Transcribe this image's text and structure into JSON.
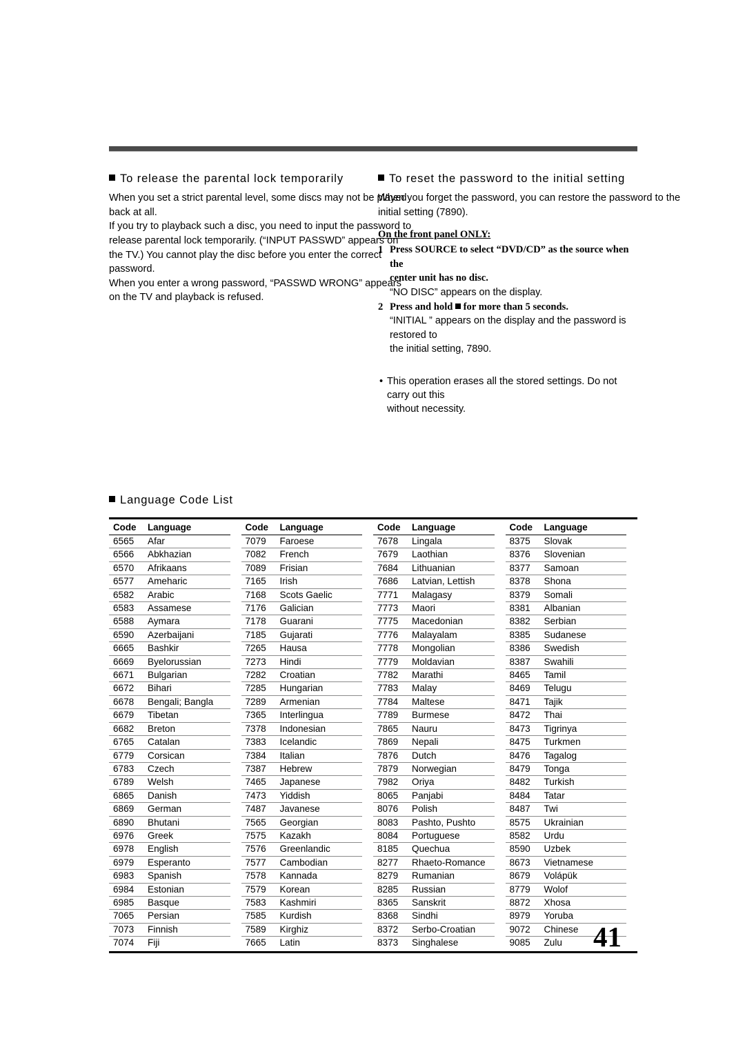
{
  "page": {
    "number": "41"
  },
  "sections": {
    "release_lock": {
      "heading": "To release the parental lock temporarily",
      "p1_line1": "When you set a strict parental level, some discs may not be played",
      "p1_line2": "back at all.",
      "p2_line1": "If you try to playback such a disc, you need to input the password to",
      "p2_line2a": "release parental lock temporarily. (",
      "p2_line2b": "“INPUT PASSWD”",
      "p2_line2c": " appears on",
      "p2_line3": "the TV.)  You cannot play the disc before you enter the correct",
      "p2_line4": "password.",
      "p3_line1a": "When you enter a wrong password, ",
      "p3_line1b": "“PASSWD WRONG”",
      "p3_line1c": " appears",
      "p3_line2": "on the TV and playback is refused."
    },
    "reset_password": {
      "heading": "To reset the password to the initial setting",
      "p1_line1": "When you forget the password, you can restore the password to the",
      "p1_line2": "initial setting (7890).",
      "front_panel_label": "On the front panel ONLY:",
      "steps": [
        {
          "num": "1",
          "bold_line1": "Press SOURCE to select “DVD/CD” as the source when the",
          "bold_line2": "center unit has no disc.",
          "plain_line": "“NO DISC” appears on the display."
        },
        {
          "num": "2",
          "bold_prefix": "Press and hold ",
          "bold_suffix": " for more than 5 seconds.",
          "plain_line1": "“INITIAL ” appears on the display and the password is restored to",
          "plain_line2": "the initial setting, 7890."
        }
      ],
      "note_line1": "This operation erases all the stored settings. Do not carry out this",
      "note_line2": "without necessity."
    }
  },
  "language_code_list": {
    "heading": "Language Code List",
    "headers": {
      "code": "Code",
      "language": "Language"
    },
    "columns": [
      [
        [
          "6565",
          "Afar"
        ],
        [
          "6566",
          "Abkhazian"
        ],
        [
          "6570",
          "Afrikaans"
        ],
        [
          "6577",
          "Ameharic"
        ],
        [
          "6582",
          "Arabic"
        ],
        [
          "6583",
          "Assamese"
        ],
        [
          "6588",
          "Aymara"
        ],
        [
          "6590",
          "Azerbaijani"
        ],
        [
          "6665",
          "Bashkir"
        ],
        [
          "6669",
          "Byelorussian"
        ],
        [
          "6671",
          "Bulgarian"
        ],
        [
          "6672",
          "Bihari"
        ],
        [
          "6678",
          "Bengali; Bangla"
        ],
        [
          "6679",
          "Tibetan"
        ],
        [
          "6682",
          "Breton"
        ],
        [
          "6765",
          "Catalan"
        ],
        [
          "6779",
          "Corsican"
        ],
        [
          "6783",
          "Czech"
        ],
        [
          "6789",
          "Welsh"
        ],
        [
          "6865",
          "Danish"
        ],
        [
          "6869",
          "German"
        ],
        [
          "6890",
          "Bhutani"
        ],
        [
          "6976",
          "Greek"
        ],
        [
          "6978",
          "English"
        ],
        [
          "6979",
          "Esperanto"
        ],
        [
          "6983",
          "Spanish"
        ],
        [
          "6984",
          "Estonian"
        ],
        [
          "6985",
          "Basque"
        ],
        [
          "7065",
          "Persian"
        ],
        [
          "7073",
          "Finnish"
        ],
        [
          "7074",
          "Fiji"
        ]
      ],
      [
        [
          "7079",
          "Faroese"
        ],
        [
          "7082",
          "French"
        ],
        [
          "7089",
          "Frisian"
        ],
        [
          "7165",
          "Irish"
        ],
        [
          "7168",
          "Scots Gaelic"
        ],
        [
          "7176",
          "Galician"
        ],
        [
          "7178",
          "Guarani"
        ],
        [
          "7185",
          "Gujarati"
        ],
        [
          "7265",
          "Hausa"
        ],
        [
          "7273",
          "Hindi"
        ],
        [
          "7282",
          "Croatian"
        ],
        [
          "7285",
          "Hungarian"
        ],
        [
          "7289",
          "Armenian"
        ],
        [
          "7365",
          "Interlingua"
        ],
        [
          "7378",
          "Indonesian"
        ],
        [
          "7383",
          "Icelandic"
        ],
        [
          "7384",
          "Italian"
        ],
        [
          "7387",
          "Hebrew"
        ],
        [
          "7465",
          "Japanese"
        ],
        [
          "7473",
          "Yiddish"
        ],
        [
          "7487",
          "Javanese"
        ],
        [
          "7565",
          "Georgian"
        ],
        [
          "7575",
          "Kazakh"
        ],
        [
          "7576",
          "Greenlandic"
        ],
        [
          "7577",
          "Cambodian"
        ],
        [
          "7578",
          "Kannada"
        ],
        [
          "7579",
          "Korean"
        ],
        [
          "7583",
          "Kashmiri"
        ],
        [
          "7585",
          "Kurdish"
        ],
        [
          "7589",
          "Kirghiz"
        ],
        [
          "7665",
          "Latin"
        ]
      ],
      [
        [
          "7678",
          "Lingala"
        ],
        [
          "7679",
          "Laothian"
        ],
        [
          "7684",
          "Lithuanian"
        ],
        [
          "7686",
          "Latvian, Lettish"
        ],
        [
          "7771",
          "Malagasy"
        ],
        [
          "7773",
          "Maori"
        ],
        [
          "7775",
          "Macedonian"
        ],
        [
          "7776",
          "Malayalam"
        ],
        [
          "7778",
          "Mongolian"
        ],
        [
          "7779",
          "Moldavian"
        ],
        [
          "7782",
          "Marathi"
        ],
        [
          "7783",
          "Malay"
        ],
        [
          "7784",
          "Maltese"
        ],
        [
          "7789",
          "Burmese"
        ],
        [
          "7865",
          "Nauru"
        ],
        [
          "7869",
          "Nepali"
        ],
        [
          "7876",
          "Dutch"
        ],
        [
          "7879",
          "Norwegian"
        ],
        [
          "7982",
          "Oriya"
        ],
        [
          "8065",
          "Panjabi"
        ],
        [
          "8076",
          "Polish"
        ],
        [
          "8083",
          "Pashto, Pushto"
        ],
        [
          "8084",
          "Portuguese"
        ],
        [
          "8185",
          "Quechua"
        ],
        [
          "8277",
          "Rhaeto-Romance"
        ],
        [
          "8279",
          "Rumanian"
        ],
        [
          "8285",
          "Russian"
        ],
        [
          "8365",
          "Sanskrit"
        ],
        [
          "8368",
          "Sindhi"
        ],
        [
          "8372",
          "Serbo-Croatian"
        ],
        [
          "8373",
          "Singhalese"
        ]
      ],
      [
        [
          "8375",
          "Slovak"
        ],
        [
          "8376",
          "Slovenian"
        ],
        [
          "8377",
          "Samoan"
        ],
        [
          "8378",
          "Shona"
        ],
        [
          "8379",
          "Somali"
        ],
        [
          "8381",
          "Albanian"
        ],
        [
          "8382",
          "Serbian"
        ],
        [
          "8385",
          "Sudanese"
        ],
        [
          "8386",
          "Swedish"
        ],
        [
          "8387",
          "Swahili"
        ],
        [
          "8465",
          "Tamil"
        ],
        [
          "8469",
          "Telugu"
        ],
        [
          "8471",
          "Tajik"
        ],
        [
          "8472",
          "Thai"
        ],
        [
          "8473",
          "Tigrinya"
        ],
        [
          "8475",
          "Turkmen"
        ],
        [
          "8476",
          "Tagalog"
        ],
        [
          "8479",
          "Tonga"
        ],
        [
          "8482",
          "Turkish"
        ],
        [
          "8484",
          "Tatar"
        ],
        [
          "8487",
          "Twi"
        ],
        [
          "8575",
          "Ukrainian"
        ],
        [
          "8582",
          "Urdu"
        ],
        [
          "8590",
          "Uzbek"
        ],
        [
          "8673",
          "Vietnamese"
        ],
        [
          "8679",
          "Volápük"
        ],
        [
          "8779",
          "Wolof"
        ],
        [
          "8872",
          "Xhosa"
        ],
        [
          "8979",
          "Yoruba"
        ],
        [
          "9072",
          "Chinese"
        ],
        [
          "9085",
          "Zulu"
        ]
      ]
    ]
  }
}
